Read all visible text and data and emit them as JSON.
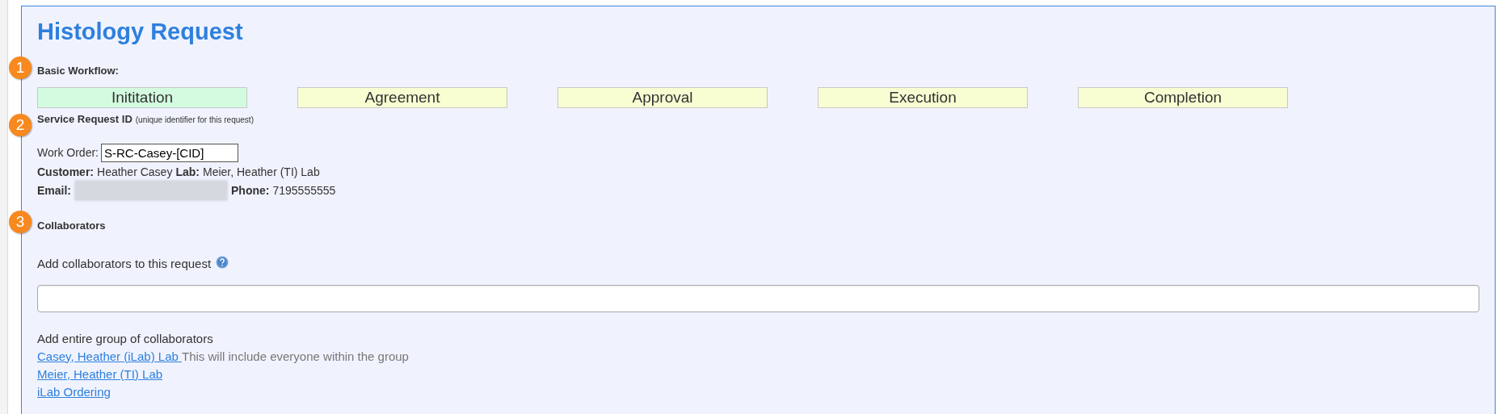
{
  "title": "Histology Request",
  "steps": [
    {
      "number": "1",
      "label": "Basic Workflow:"
    },
    {
      "number": "2",
      "label": "Service Request ID",
      "note": "(unique identifier for this request)"
    },
    {
      "number": "3",
      "label": "Collaborators"
    }
  ],
  "workflow": [
    {
      "label": "Inititation",
      "selected": true
    },
    {
      "label": "Agreement",
      "selected": false
    },
    {
      "label": "Approval",
      "selected": false
    },
    {
      "label": "Execution",
      "selected": false
    },
    {
      "label": "Completion",
      "selected": false
    }
  ],
  "work_order": {
    "label": "Work Order:",
    "value": "S-RC-Casey-[CID]"
  },
  "customer": {
    "label": "Customer:",
    "value": "Heather Casey"
  },
  "lab": {
    "label": "Lab:",
    "value": "Meier, Heather (TI) Lab"
  },
  "email": {
    "label": "Email:",
    "redacted": true
  },
  "phone": {
    "label": "Phone:",
    "value": "7195555555"
  },
  "collaborators": {
    "label": "Add collaborators to this request",
    "groups_label": "Add entire group of collaborators",
    "groups": [
      {
        "link": "Casey, Heather (iLab) Lab ",
        "hint": "This will include everyone within the group"
      },
      {
        "link": "Meier, Heather (TI) Lab"
      },
      {
        "link": "iLab Ordering"
      }
    ]
  }
}
